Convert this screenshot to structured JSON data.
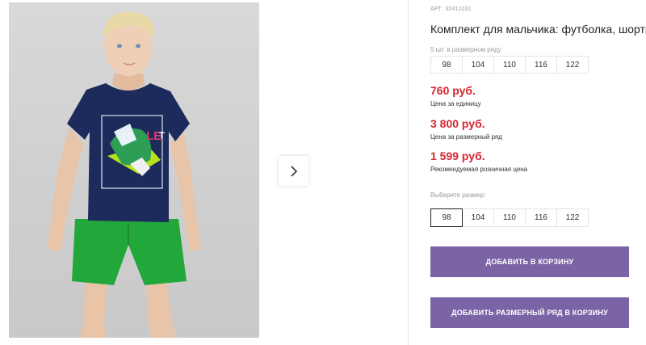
{
  "gallery": {
    "next_icon": "chevron-right-icon"
  },
  "product": {
    "article": "АРТ: 32412031",
    "title": "Комплект для мальчика: футболка, шорты",
    "pack_note": "5 шт. в размерном ряду",
    "size_range": [
      "98",
      "104",
      "110",
      "116",
      "122"
    ],
    "prices": [
      {
        "value": "760 руб.",
        "label": "Цена за единицу"
      },
      {
        "value": "3 800 руб.",
        "label": "Цена за размерный ряд"
      },
      {
        "value": "1 599 руб.",
        "label": "Рекомендуемая розничная цена"
      }
    ],
    "choose_size_label": "Выберите размер:",
    "selectable_sizes": [
      "98",
      "104",
      "110",
      "116",
      "122"
    ],
    "selected_size": "98",
    "add_to_cart": "ДОБАВИТЬ В КОРЗИНУ",
    "add_range_to_cart": "ДОБАВИТЬ РАЗМЕРНЫЙ РЯД В КОРЗИНУ"
  },
  "colors": {
    "price": "#d8252f",
    "button": "#7b64a6",
    "shirt": "#1c2a5c",
    "shorts": "#22a83a"
  }
}
